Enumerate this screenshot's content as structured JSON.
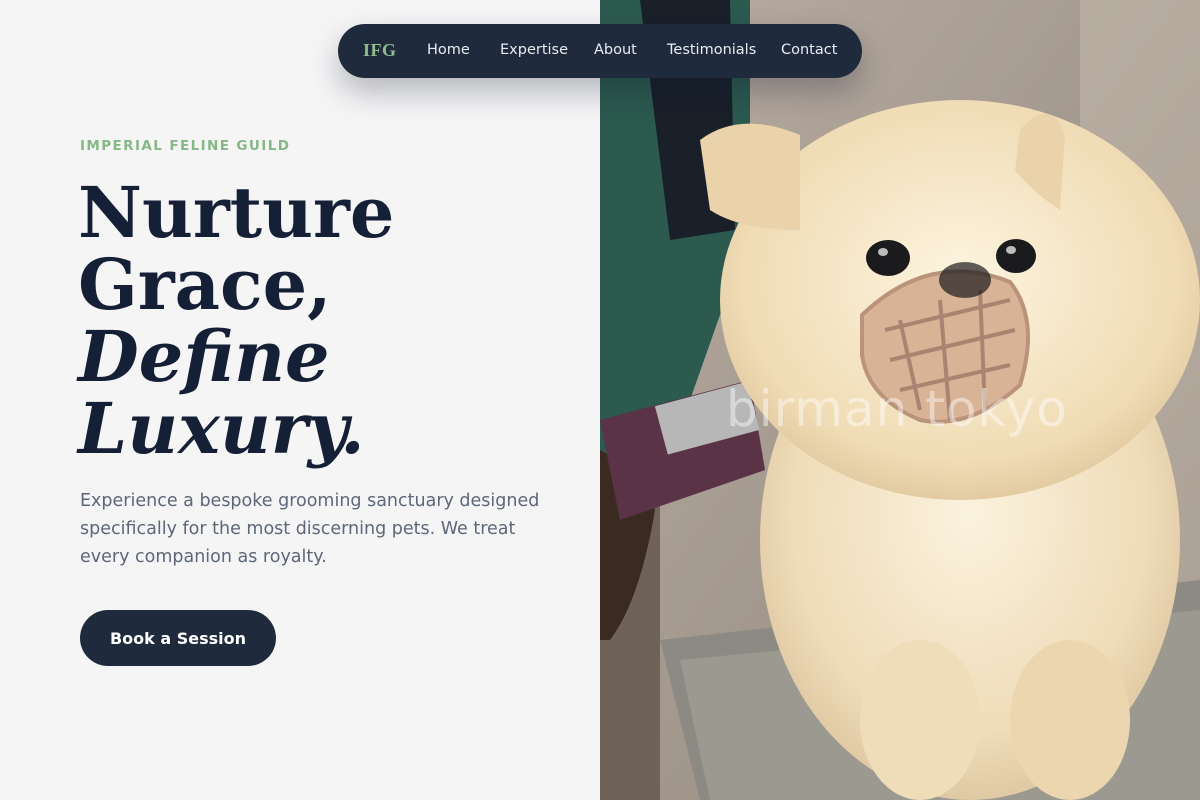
{
  "nav": {
    "logo": "IFG",
    "links": [
      "Home",
      "Expertise",
      "About",
      "Testimonials",
      "Contact"
    ]
  },
  "hero": {
    "eyebrow": "IMPERIAL FELINE GUILD",
    "headline": [
      "Nurture",
      "Grace,",
      "Define",
      "Luxury."
    ],
    "description": "Experience a bespoke grooming sanctuary designed specifically for the most discerning pets. We treat every companion as royalty.",
    "cta_label": "Book a Session"
  },
  "image": {
    "watermark": "birman tokyo"
  },
  "colors": {
    "navy": "#1f2a3c",
    "accent_green": "#86b886",
    "background": "#f5f5f6",
    "body_text": "#5d6778"
  }
}
